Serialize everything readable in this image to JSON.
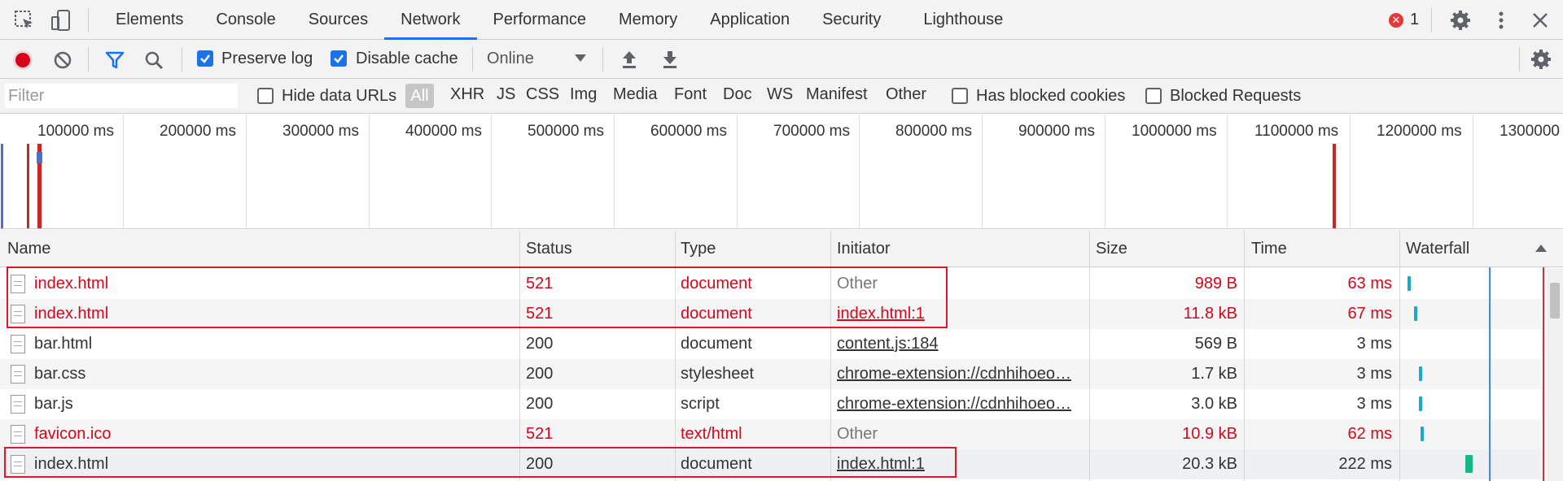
{
  "tabs": [
    {
      "label": "Elements"
    },
    {
      "label": "Console"
    },
    {
      "label": "Sources"
    },
    {
      "label": "Network"
    },
    {
      "label": "Performance"
    },
    {
      "label": "Memory"
    },
    {
      "label": "Application"
    },
    {
      "label": "Security"
    },
    {
      "label": "Lighthouse"
    }
  ],
  "active_tab": "Network",
  "error_count": "1",
  "toolbar": {
    "preserve_log_label": "Preserve log",
    "preserve_log_checked": true,
    "disable_cache_label": "Disable cache",
    "disable_cache_checked": true,
    "throttling_value": "Online"
  },
  "filter": {
    "placeholder": "Filter",
    "hide_data_urls_label": "Hide data URLs",
    "types": [
      "All",
      "XHR",
      "JS",
      "CSS",
      "Img",
      "Media",
      "Font",
      "Doc",
      "WS",
      "Manifest",
      "Other"
    ],
    "selected_type": "All",
    "has_blocked_cookies_label": "Has blocked cookies",
    "blocked_requests_label": "Blocked Requests"
  },
  "overview": {
    "tick_labels": [
      "100000 ms",
      "200000 ms",
      "300000 ms",
      "400000 ms",
      "500000 ms",
      "600000 ms",
      "700000 ms",
      "800000 ms",
      "900000 ms",
      "1000000 ms",
      "1100000 ms",
      "1200000 ms",
      "1300000"
    ]
  },
  "table": {
    "columns": [
      "Name",
      "Status",
      "Type",
      "Initiator",
      "Size",
      "Time",
      "Waterfall"
    ],
    "rows": [
      {
        "name": "index.html",
        "status": "521",
        "type": "document",
        "initiator": "Other",
        "initiator_link": false,
        "size": "989 B",
        "time": "63 ms",
        "error": true
      },
      {
        "name": "index.html",
        "status": "521",
        "type": "document",
        "initiator": "index.html:1",
        "initiator_link": true,
        "size": "11.8 kB",
        "time": "67 ms",
        "error": true
      },
      {
        "name": "bar.html",
        "status": "200",
        "type": "document",
        "initiator": "content.js:184",
        "initiator_link": true,
        "size": "569 B",
        "time": "3 ms",
        "error": false
      },
      {
        "name": "bar.css",
        "status": "200",
        "type": "stylesheet",
        "initiator": "chrome-extension://cdnhihoeo…",
        "initiator_link": true,
        "size": "1.7 kB",
        "time": "3 ms",
        "error": false
      },
      {
        "name": "bar.js",
        "status": "200",
        "type": "script",
        "initiator": "chrome-extension://cdnhihoeo…",
        "initiator_link": true,
        "size": "3.0 kB",
        "time": "3 ms",
        "error": false
      },
      {
        "name": "favicon.ico",
        "status": "521",
        "type": "text/html",
        "initiator": "Other",
        "initiator_link": false,
        "size": "10.9 kB",
        "time": "62 ms",
        "error": true
      },
      {
        "name": "index.html",
        "status": "200",
        "type": "document",
        "initiator": "index.html:1",
        "initiator_link": true,
        "size": "20.3 kB",
        "time": "222 ms",
        "error": false
      }
    ]
  },
  "colors": {
    "error_text": "#d6061b",
    "accent": "#1a73e8",
    "highlight_box": "#d81b2c"
  }
}
